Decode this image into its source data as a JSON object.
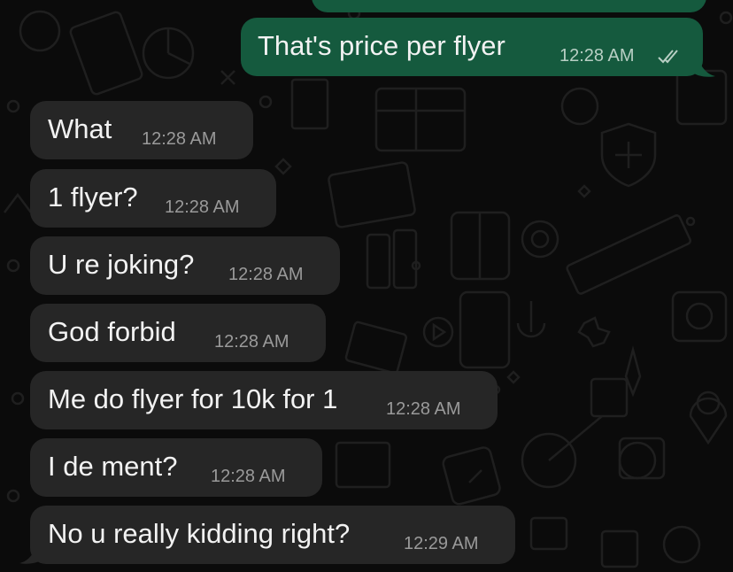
{
  "chat": {
    "messages": [
      {
        "direction": "out",
        "text": "That's price per flyer",
        "time": "12:28 AM",
        "status": "read-double-check-icon"
      },
      {
        "direction": "in",
        "text": "What",
        "time": "12:28 AM"
      },
      {
        "direction": "in",
        "text": "1 flyer?",
        "time": "12:28 AM"
      },
      {
        "direction": "in",
        "text": "U re joking?",
        "time": "12:28 AM"
      },
      {
        "direction": "in",
        "text": "God forbid",
        "time": "12:28 AM"
      },
      {
        "direction": "in",
        "text": "Me do flyer for 10k for 1",
        "time": "12:28 AM"
      },
      {
        "direction": "in",
        "text": "I de ment?",
        "time": "12:28 AM"
      },
      {
        "direction": "in",
        "text": "No u really kidding right?",
        "time": "12:29 AM"
      }
    ]
  },
  "colors": {
    "background": "#0b0b0b",
    "incoming_bubble": "#262626",
    "outgoing_bubble": "#155a3e",
    "message_text": "#f2f2f2",
    "timestamp_text": "#9a9a9a"
  }
}
